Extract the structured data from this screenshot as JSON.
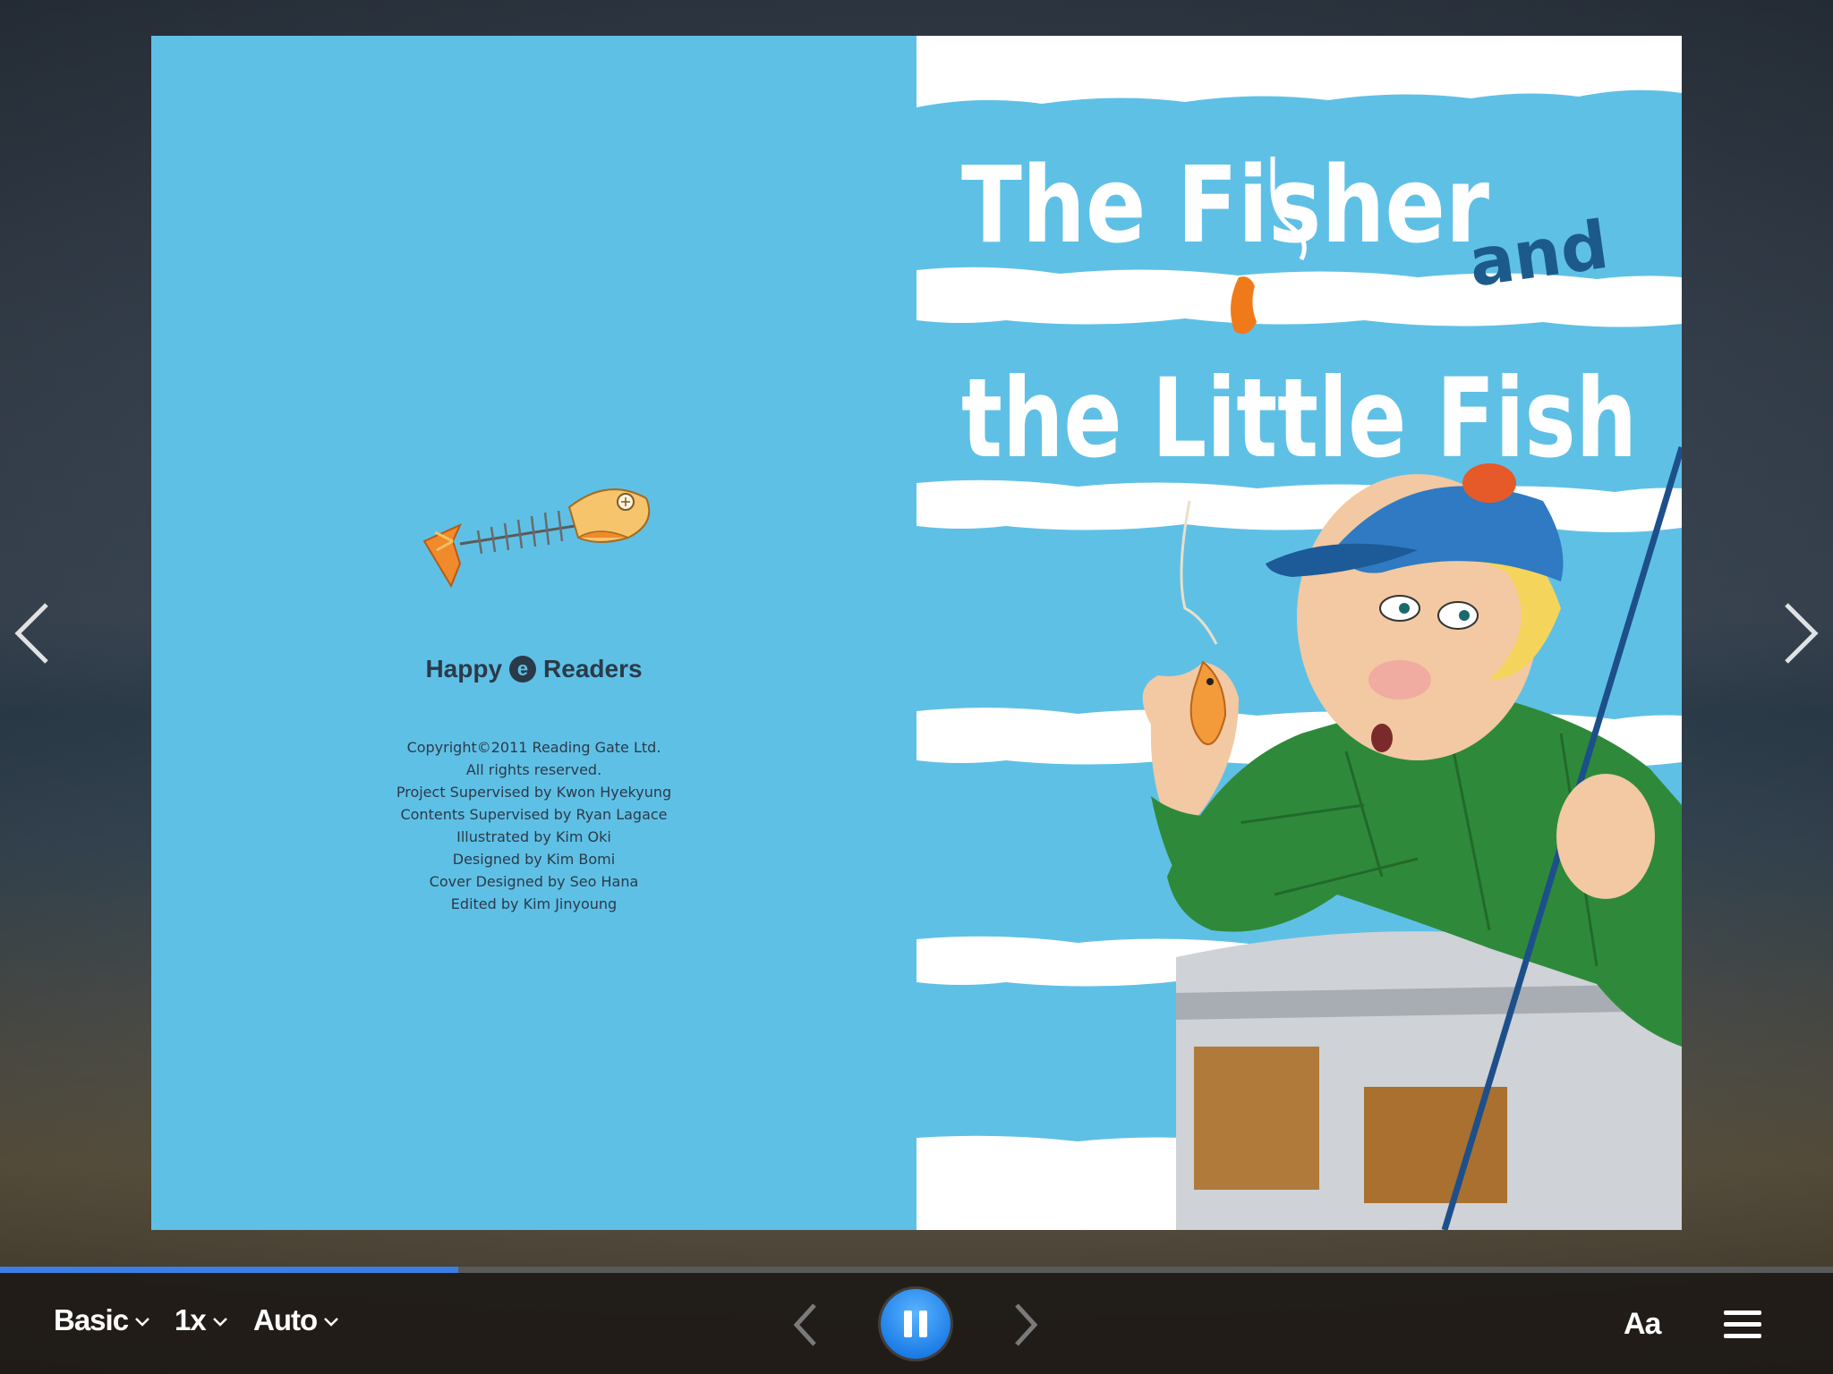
{
  "book": {
    "left_page": {
      "publisher": {
        "prefix": "Happy",
        "badge": "e",
        "suffix": "Readers"
      },
      "credits": [
        "Copyright©2011 Reading Gate Ltd.",
        "All rights reserved.",
        "Project Supervised by Kwon Hyekyung",
        "Contents Supervised by Ryan Lagace",
        "Illustrated by Kim Oki",
        "Designed by Kim Bomi",
        "Cover Designed by Seo Hana",
        "Edited by Kim Jinyoung"
      ]
    },
    "cover": {
      "line1": "The Fisher",
      "connector": "and",
      "line2": "the Little Fish"
    }
  },
  "navigation": {
    "prev_icon": "chevron-left-icon",
    "next_icon": "chevron-right-icon"
  },
  "progress": {
    "fraction": 0.25
  },
  "toolbar": {
    "mode_label": "Basic",
    "speed_label": "1x",
    "auto_label": "Auto",
    "font_label": "Aa",
    "pause_icon": "pause-icon",
    "menu_icon": "hamburger-menu-icon"
  },
  "colors": {
    "page_blue": "#5fc0e6",
    "accent_blue": "#1f7fe8",
    "progress_blue": "#3a7fe6",
    "title_dark_blue": "#1d5a8c",
    "toolbar_bg": "#1e1a16"
  }
}
